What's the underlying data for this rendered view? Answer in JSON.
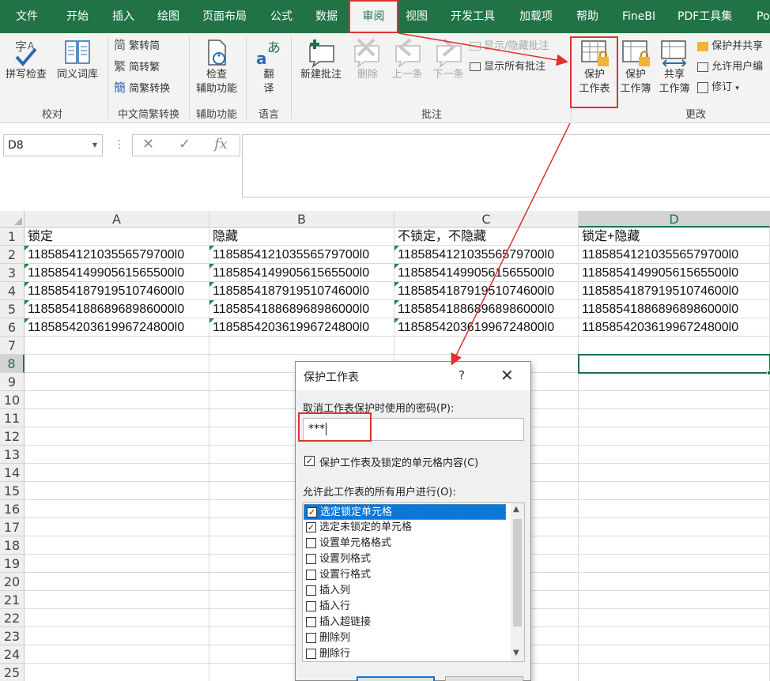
{
  "tabs": [
    {
      "label": "文件",
      "active": false
    },
    {
      "label": "开始",
      "active": false
    },
    {
      "label": "插入",
      "active": false
    },
    {
      "label": "绘图",
      "active": false
    },
    {
      "label": "页面布局",
      "active": false
    },
    {
      "label": "公式",
      "active": false
    },
    {
      "label": "数据",
      "active": false
    },
    {
      "label": "审阅",
      "active": true
    },
    {
      "label": "视图",
      "active": false
    },
    {
      "label": "开发工具",
      "active": false
    },
    {
      "label": "加载项",
      "active": false
    },
    {
      "label": "帮助",
      "active": false
    },
    {
      "label": "FineBI",
      "active": false
    },
    {
      "label": "PDF工具集",
      "active": false
    },
    {
      "label": "Po",
      "active": false
    }
  ],
  "ribbon": {
    "proofing": {
      "spell": "拼写检查",
      "thesaurus": "同义词库",
      "group": "校对"
    },
    "chinese": {
      "t2s": "繁转简",
      "s2t": "简转繁",
      "convert": "简繁转换",
      "group": "中文简繁转换"
    },
    "accessibility": {
      "check_line1": "检查",
      "check_line2": "辅助功能",
      "group": "辅助功能"
    },
    "language": {
      "translate_line1": "翻",
      "translate_line2": "译",
      "group": "语言"
    },
    "comments": {
      "new": "新建批注",
      "delete": "删除",
      "prev": "上一条",
      "next": "下一条",
      "show_hide": "显示/隐藏批注",
      "show_all": "显示所有批注",
      "group": "批注"
    },
    "changes": {
      "protect_sheet_line1": "保护",
      "protect_sheet_line2": "工作表",
      "protect_book_line1": "保护",
      "protect_book_line2": "工作簿",
      "share_line1": "共享",
      "share_line2": "工作簿",
      "protect_share": "保护并共享",
      "allow_edit": "允许用户编",
      "track": "修订",
      "group": "更改"
    }
  },
  "formula_bar": {
    "name_box": "D8",
    "cancel": "✕",
    "enter": "✓",
    "fx": "fx",
    "formula": ""
  },
  "sheet": {
    "columns": [
      "A",
      "B",
      "C",
      "D"
    ],
    "rows": [
      "1",
      "2",
      "3",
      "4",
      "5",
      "6",
      "7",
      "8",
      "9",
      "10",
      "11",
      "12",
      "13",
      "14",
      "15",
      "16",
      "17",
      "18",
      "19",
      "20",
      "21",
      "22",
      "23",
      "24",
      "25"
    ],
    "headers": [
      "锁定",
      "隐藏",
      "不锁定，不隐藏",
      "锁定+隐藏"
    ],
    "values": [
      "118585412103556579700l0",
      "118585414990561565500l0",
      "118585418791951074600l0",
      "118585418868968986000l0",
      "118585420361996724800l0"
    ],
    "selected_cell": "D8"
  },
  "dialog": {
    "title": "保护工作表",
    "help": "?",
    "close": "✕",
    "password_label": "取消工作表保护时使用的密码(P):",
    "password_value": "***",
    "protect_label": "保护工作表及锁定的单元格内容(C)",
    "protect_checked": true,
    "allow_label": "允许此工作表的所有用户进行(O):",
    "permissions": [
      {
        "label": "选定锁定单元格",
        "checked": true
      },
      {
        "label": "选定未锁定的单元格",
        "checked": true
      },
      {
        "label": "设置单元格格式",
        "checked": false
      },
      {
        "label": "设置列格式",
        "checked": false
      },
      {
        "label": "设置行格式",
        "checked": false
      },
      {
        "label": "插入列",
        "checked": false
      },
      {
        "label": "插入行",
        "checked": false
      },
      {
        "label": "插入超链接",
        "checked": false
      },
      {
        "label": "删除列",
        "checked": false
      },
      {
        "label": "删除行",
        "checked": false
      }
    ]
  },
  "colors": {
    "excel_green": "#217346",
    "highlight_red": "#e0312f",
    "selection_blue": "#0a78d7"
  }
}
